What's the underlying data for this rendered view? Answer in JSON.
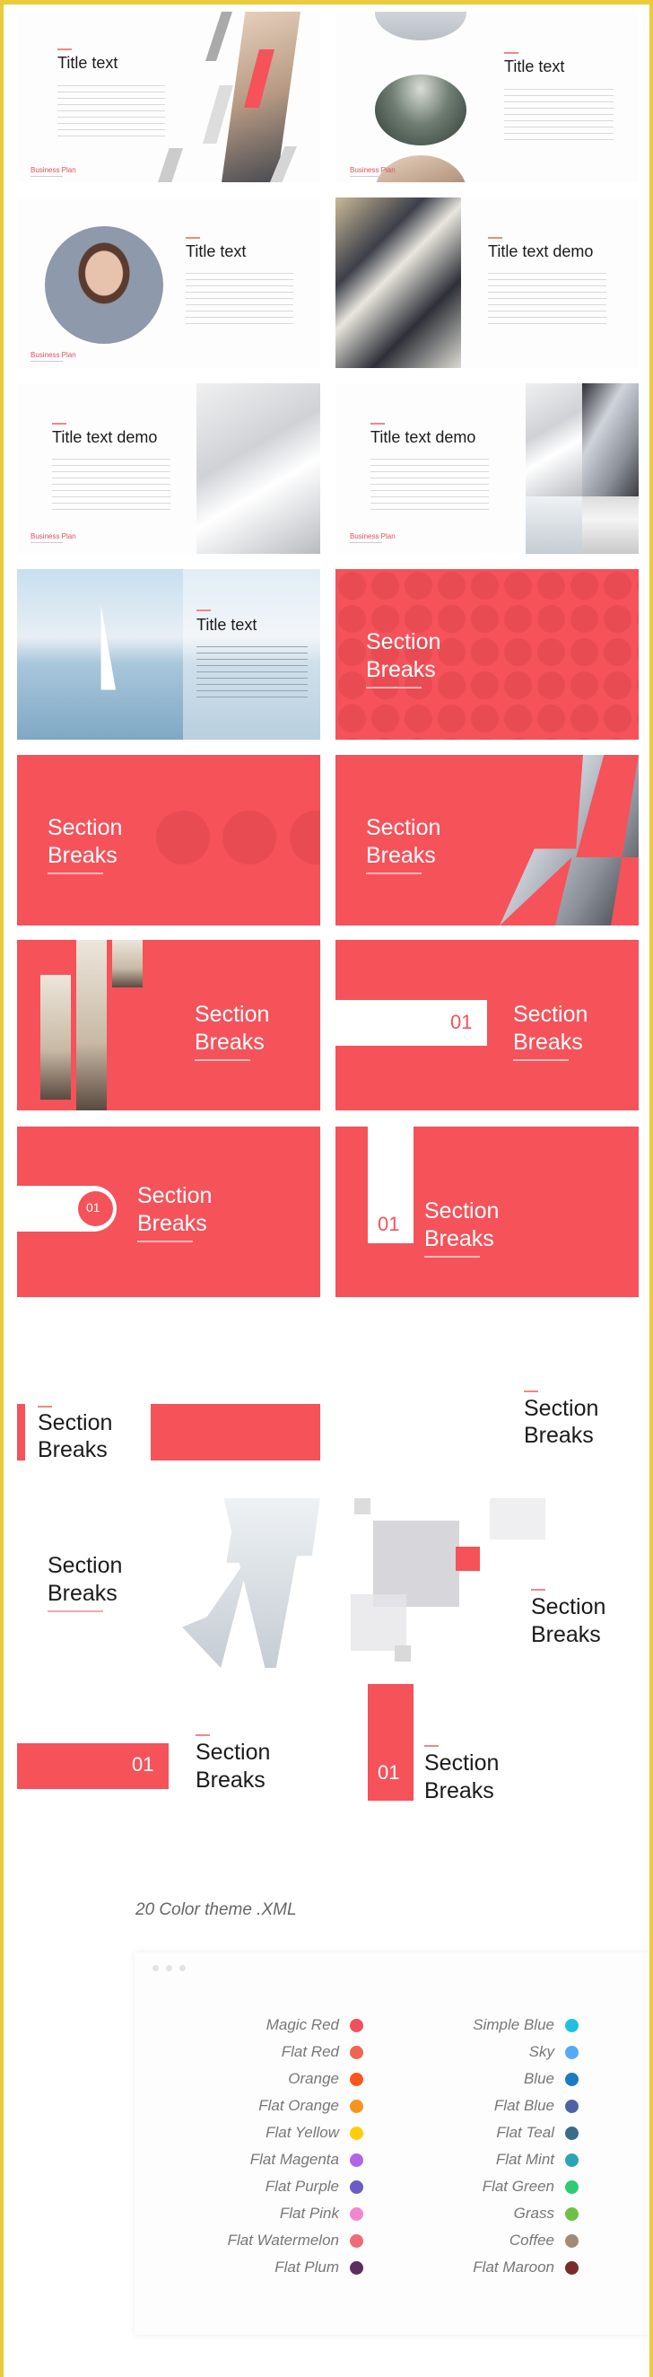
{
  "accent": "#f5525a",
  "content_slides": [
    {
      "title": "Title text",
      "footer": "Business Plan"
    },
    {
      "title": "Title text",
      "footer": "Business Plan"
    },
    {
      "title": "Title text",
      "footer": "Business Plan"
    },
    {
      "title": "Title text demo"
    },
    {
      "title": "Title text demo",
      "footer": "Business Plan"
    },
    {
      "title": "Title text demo",
      "footer": "Business Plan"
    },
    {
      "title": "Title text"
    }
  ],
  "section_break": {
    "line1": "Section",
    "line2": "Breaks",
    "number": "01"
  },
  "color_theme": {
    "title": "20 Color theme .XML",
    "left": [
      {
        "name": "Magic Red",
        "color": "#f0505a"
      },
      {
        "name": "Flat Red",
        "color": "#ee6651"
      },
      {
        "name": "Orange",
        "color": "#f9561f"
      },
      {
        "name": "Flat Orange",
        "color": "#f7941d"
      },
      {
        "name": "Flat Yellow",
        "color": "#fecd0b"
      },
      {
        "name": "Flat Magenta",
        "color": "#b065e5"
      },
      {
        "name": "Flat Purple",
        "color": "#6a5cc4"
      },
      {
        "name": "Flat Pink",
        "color": "#f386cf"
      },
      {
        "name": "Flat Watermelon",
        "color": "#ef6a7a"
      },
      {
        "name": "Flat Plum",
        "color": "#5c2d5f"
      }
    ],
    "right": [
      {
        "name": "Simple Blue",
        "color": "#22bfe0"
      },
      {
        "name": "Sky",
        "color": "#55aaf5"
      },
      {
        "name": "Blue",
        "color": "#1a7ac2"
      },
      {
        "name": "Flat Blue",
        "color": "#5062a6"
      },
      {
        "name": "Flat Teal",
        "color": "#366e8c"
      },
      {
        "name": "Flat Mint",
        "color": "#2aa5b5"
      },
      {
        "name": "Flat Green",
        "color": "#2ecc71"
      },
      {
        "name": "Grass",
        "color": "#6fc146"
      },
      {
        "name": "Coffee",
        "color": "#a38a75"
      },
      {
        "name": "Flat Maroon",
        "color": "#7b2a2a"
      }
    ]
  }
}
